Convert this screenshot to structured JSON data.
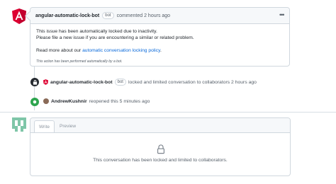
{
  "comment": {
    "author": "angular-automatic-lock-bot",
    "badge": "bot",
    "meta": "commented 2 hours ago",
    "menu_icon": "kebab-horizontal-icon",
    "body_line1": "This issue has been automatically locked due to inactivity.",
    "body_line2": "Please file a new issue if you are encountering a similar or related problem.",
    "read_more_prefix": "Read more about our ",
    "read_more_link": "automatic conversation locking policy",
    "read_more_suffix": ".",
    "footnote": "This action has been performed automatically by a bot."
  },
  "events": [
    {
      "icon": "lock-icon",
      "author": "angular-automatic-lock-bot",
      "badge": "bot",
      "text": "locked and limited conversation to collaborators 2 hours ago"
    },
    {
      "icon": "dot-fill-icon",
      "author": "AndrewKushnir",
      "text": "reopened this 5 minutes ago"
    }
  ],
  "composer": {
    "tab_write": "Write",
    "tab_preview": "Preview",
    "locked_message": "This conversation has been locked and limited to collaborators."
  },
  "colors": {
    "angular_red": "#dd0031",
    "reopened_green": "#2da44e",
    "link_blue": "#0969da"
  }
}
